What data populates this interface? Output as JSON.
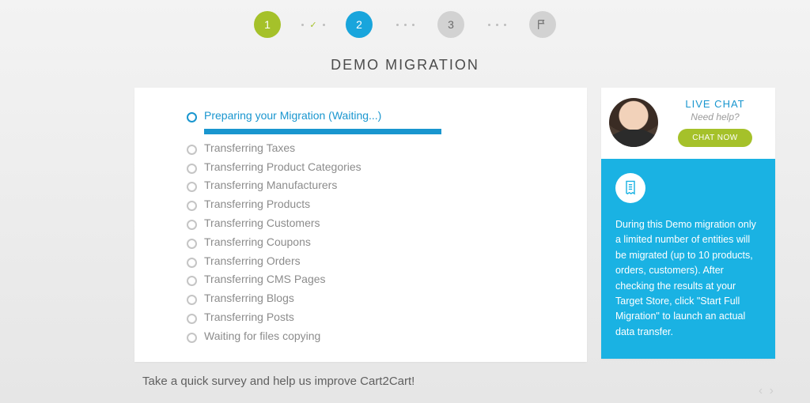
{
  "stepper": {
    "steps": [
      "1",
      "2",
      "3"
    ],
    "doneIndex": 0,
    "activeIndex": 1
  },
  "title": "DEMO MIGRATION",
  "progress": {
    "activeIndex": 0,
    "items": [
      "Preparing your Migration (Waiting...)",
      "Transferring Taxes",
      "Transferring Product Categories",
      "Transferring Manufacturers",
      "Transferring Products",
      "Transferring Customers",
      "Transferring Coupons",
      "Transferring Orders",
      "Transferring CMS Pages",
      "Transferring Blogs",
      "Transferring Posts",
      "Waiting for files copying"
    ]
  },
  "liveChat": {
    "title": "LIVE CHAT",
    "subtitle": "Need help?",
    "button": "CHAT NOW"
  },
  "infoBox": {
    "text": "During this Demo migration only a limited number of entities will be migrated (up to 10 products, orders, customers). After checking the results at your Target Store, click \"Start Full Migration\" to launch an actual data transfer."
  },
  "survey": "Take a quick survey and help us improve Cart2Cart!"
}
